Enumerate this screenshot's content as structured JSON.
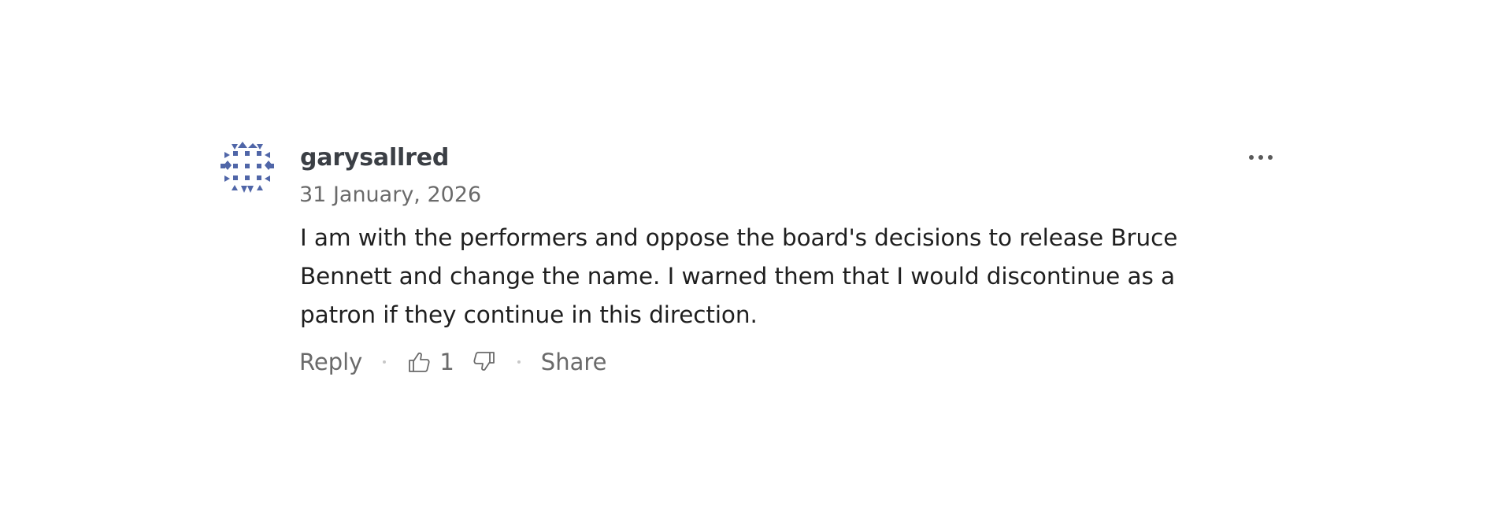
{
  "comment": {
    "username": "garysallred",
    "date": "31 January, 2026",
    "text": "I am with the performers and oppose the board's decisions to release Bruce Bennett and change the name. I warned them that I would discontinue as a patron if they continue in this direction.",
    "actions": {
      "reply_label": "Reply",
      "like_count": "1",
      "share_label": "Share"
    },
    "avatar_icon": "geometric-pattern-avatar",
    "avatar_color": "#5066a8",
    "more_icon": "ellipsis-icon"
  }
}
